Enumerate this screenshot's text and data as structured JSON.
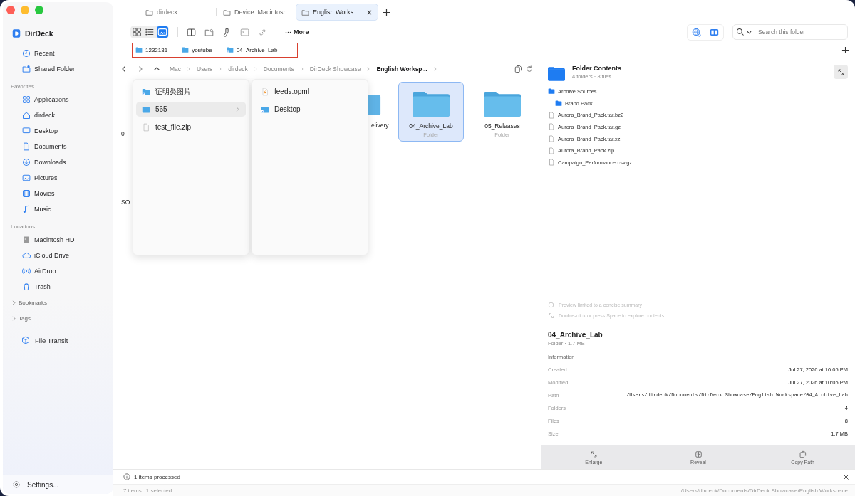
{
  "sidebar": {
    "app_name": "DirDeck",
    "top_items": [
      {
        "label": "Recent",
        "kind": "clock",
        "selected": false
      },
      {
        "label": "Shared Folder",
        "kind": "shared",
        "selected": false
      }
    ],
    "sections": [
      {
        "title": "Favorites",
        "items": [
          {
            "label": "Applications",
            "kind": "apps"
          },
          {
            "label": "dirdeck",
            "kind": "home"
          },
          {
            "label": "Desktop",
            "kind": "desktop"
          },
          {
            "label": "Documents",
            "kind": "document"
          },
          {
            "label": "Downloads",
            "kind": "download"
          },
          {
            "label": "Pictures",
            "kind": "pictures"
          },
          {
            "label": "Movies",
            "kind": "movies"
          },
          {
            "label": "Music",
            "kind": "music"
          }
        ]
      },
      {
        "title": "Locations",
        "items": [
          {
            "label": "Macintosh HD",
            "kind": "disk"
          },
          {
            "label": "iCloud Drive",
            "kind": "cloud"
          },
          {
            "label": "AirDrop",
            "kind": "airdrop"
          },
          {
            "label": "Trash",
            "kind": "trash"
          }
        ]
      }
    ],
    "groups": [
      {
        "label": "Bookmarks",
        "expanded": false
      },
      {
        "label": "Tags",
        "expanded": false
      }
    ],
    "transit": "File Transit",
    "settings": "Settings..."
  },
  "tabs": [
    {
      "label": "dirdeck",
      "selected": false
    },
    {
      "label": "Device: Macintosh...",
      "selected": false
    },
    {
      "label": "English Works...",
      "selected": true
    }
  ],
  "toolbar": {
    "view_modes": [
      {
        "kind": "grid",
        "selected": false
      },
      {
        "kind": "list",
        "selected": false
      },
      {
        "kind": "gallery",
        "selected": true
      }
    ],
    "more": "More",
    "search": {
      "placeholder": "Search this folder"
    }
  },
  "pinned": [
    {
      "label": "1232131",
      "kind": "folder"
    },
    {
      "label": "youtube",
      "kind": "folder"
    },
    {
      "label": "04_Archive_Lab",
      "kind": "linked"
    }
  ],
  "breadcrumb": [
    {
      "label": "Mac",
      "current": false
    },
    {
      "label": "Users",
      "current": false
    },
    {
      "label": "dirdeck",
      "current": false
    },
    {
      "label": "Documents",
      "current": false
    },
    {
      "label": "DirDeck Showcase",
      "current": false
    },
    {
      "label": "English Worksp...",
      "current": true
    }
  ],
  "grid": [
    {
      "kind": "fragment",
      "label": "0"
    },
    {
      "kind": "partial",
      "label": "elivery"
    },
    {
      "kind": "folder",
      "label": "04_Archive_Lab",
      "sub": "Folder",
      "selected": true
    },
    {
      "kind": "folder",
      "label": "05_Releases",
      "sub": "Folder",
      "selected": false
    },
    {
      "kind": "fragment",
      "label": "SO"
    }
  ],
  "popup_columns": [
    [
      {
        "label": "证明类图片",
        "kind": "linked",
        "selected": false,
        "has_children": false
      },
      {
        "label": "565",
        "kind": "folder",
        "selected": true,
        "has_children": true
      },
      {
        "label": "test_file.zip",
        "kind": "file",
        "selected": false,
        "has_children": false
      }
    ],
    [
      {
        "label": "feeds.opml",
        "kind": "feed",
        "selected": false,
        "has_children": false
      },
      {
        "label": "Desktop",
        "kind": "linked",
        "selected": false,
        "has_children": false
      }
    ]
  ],
  "preview": {
    "title": "Folder Contents",
    "summary": "4 folders · 8 files",
    "tree": [
      {
        "label": "Archive Sources",
        "kind": "folder",
        "children": [
          {
            "label": "Brand Pack",
            "kind": "folder"
          }
        ]
      },
      {
        "label": "Aurora_Brand_Pack.tar.bz2",
        "kind": "file"
      },
      {
        "label": "Aurora_Brand_Pack.tar.gz",
        "kind": "file"
      },
      {
        "label": "Aurora_Brand_Pack.tar.xz",
        "kind": "file"
      },
      {
        "label": "Aurora_Brand_Pack.zip",
        "kind": "file"
      },
      {
        "label": "Campaign_Performance.csv.gz",
        "kind": "file"
      }
    ],
    "hints": [
      {
        "label": "Preview limited to a concise summary",
        "kind": "limit"
      },
      {
        "label": "Double-click or press Space to explore contents",
        "kind": "expand"
      }
    ],
    "name": "04_Archive_Lab",
    "meta": "Folder · 1.7 MB",
    "info_title": "Information",
    "info": [
      {
        "key": "Created",
        "value": "Jul 27, 2026 at 10:05 PM",
        "mono": false
      },
      {
        "key": "Modified",
        "value": "Jul 27, 2026 at 10:05 PM",
        "mono": false
      },
      {
        "key": "Path",
        "value": "/Users/dirdeck/Documents/DirDeck Showcase/English Workspace/04_Archive_Lab",
        "mono": true
      },
      {
        "key": "Folders",
        "value": "4",
        "mono": false
      },
      {
        "key": "Files",
        "value": "8",
        "mono": false
      },
      {
        "key": "Size",
        "value": "1.7 MB",
        "mono": false
      }
    ],
    "actions": [
      {
        "label": "Enlarge",
        "kind": "enlarge"
      },
      {
        "label": "Reveal",
        "kind": "reveal"
      },
      {
        "label": "Copy Path",
        "kind": "copy"
      }
    ]
  },
  "status": {
    "message": "1 items processed",
    "count": "7 items",
    "selected": "1 selected",
    "path": "/Users/dirdeck/Documents/DirDeck Showcase/English Workspace"
  }
}
